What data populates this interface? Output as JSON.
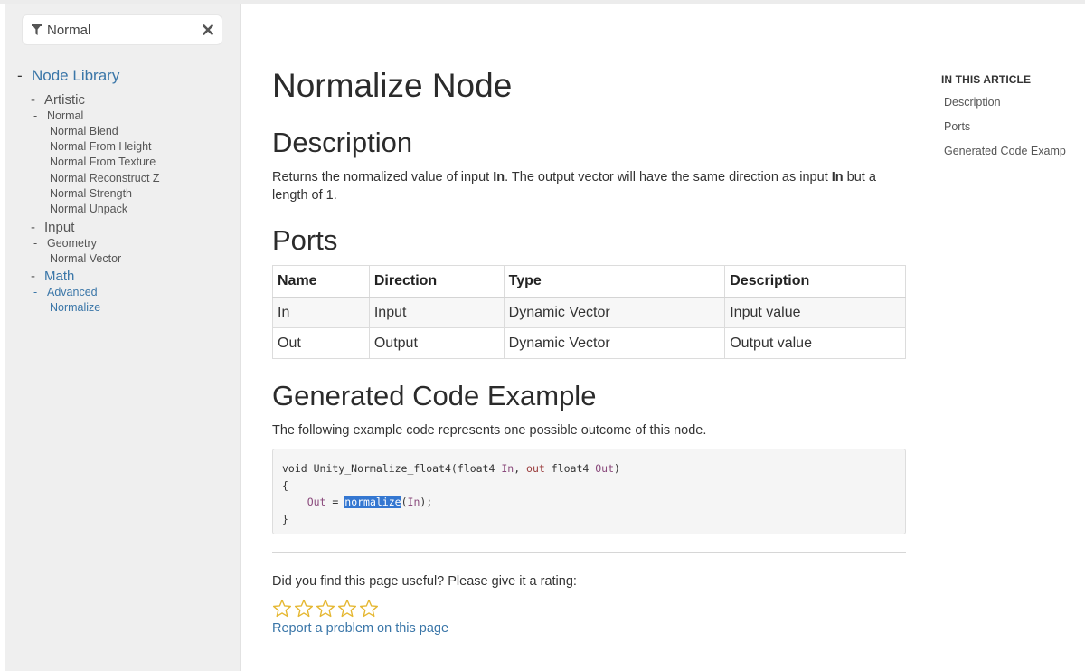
{
  "filter": {
    "value": "Normal"
  },
  "sidebar": {
    "root_label": "Node Library",
    "artistic": {
      "label": "Artistic",
      "normal": {
        "label": "Normal",
        "items": [
          "Normal Blend",
          "Normal From Height",
          "Normal From Texture",
          "Normal Reconstruct Z",
          "Normal Strength",
          "Normal Unpack"
        ]
      }
    },
    "input": {
      "label": "Input",
      "geometry": {
        "label": "Geometry",
        "items": [
          "Normal Vector"
        ]
      }
    },
    "math": {
      "label": "Math",
      "advanced": {
        "label": "Advanced",
        "items": [
          "Normalize"
        ]
      }
    }
  },
  "page": {
    "title": "Normalize Node",
    "description_heading": "Description",
    "description": {
      "p1": "Returns the normalized value of input ",
      "b1": "In",
      "p2": ". The output vector will have the same direction as input ",
      "b2": "In",
      "p3": " but a length of 1."
    },
    "ports_heading": "Ports",
    "ports_table": {
      "headers": [
        "Name",
        "Direction",
        "Type",
        "Description"
      ],
      "rows": [
        [
          "In",
          "Input",
          "Dynamic Vector",
          "Input value"
        ],
        [
          "Out",
          "Output",
          "Dynamic Vector",
          "Output value"
        ]
      ]
    },
    "code_heading": "Generated Code Example",
    "code_intro": "The following example code represents one possible outcome of this node.",
    "code": {
      "l1_a": "void Unity_Normalize_float4(float4 ",
      "l1_in": "In",
      "l1_b": ", ",
      "l1_out_kw": "out",
      "l1_c": " float4 ",
      "l1_out": "Out",
      "l1_d": ")",
      "l2": "{",
      "l3_indent": "    ",
      "l3_out": "Out",
      "l3_eq": " = ",
      "l3_fn": "normalize",
      "l3_arg_open": "(",
      "l3_in": "In",
      "l3_end": ");",
      "l4": "}"
    },
    "rating_prompt": "Did you find this page useful? Please give it a rating:",
    "rating": {
      "value": 0,
      "max": 5
    },
    "report_link": "Report a problem on this page"
  },
  "toc": {
    "heading": "IN THIS ARTICLE",
    "items": [
      "Description",
      "Ports",
      "Generated Code Examp"
    ]
  },
  "colors": {
    "link": "#3a76a8",
    "sidebar_bg": "#efefef",
    "star": "#e5b731",
    "code_highlight": "#3477d1"
  }
}
